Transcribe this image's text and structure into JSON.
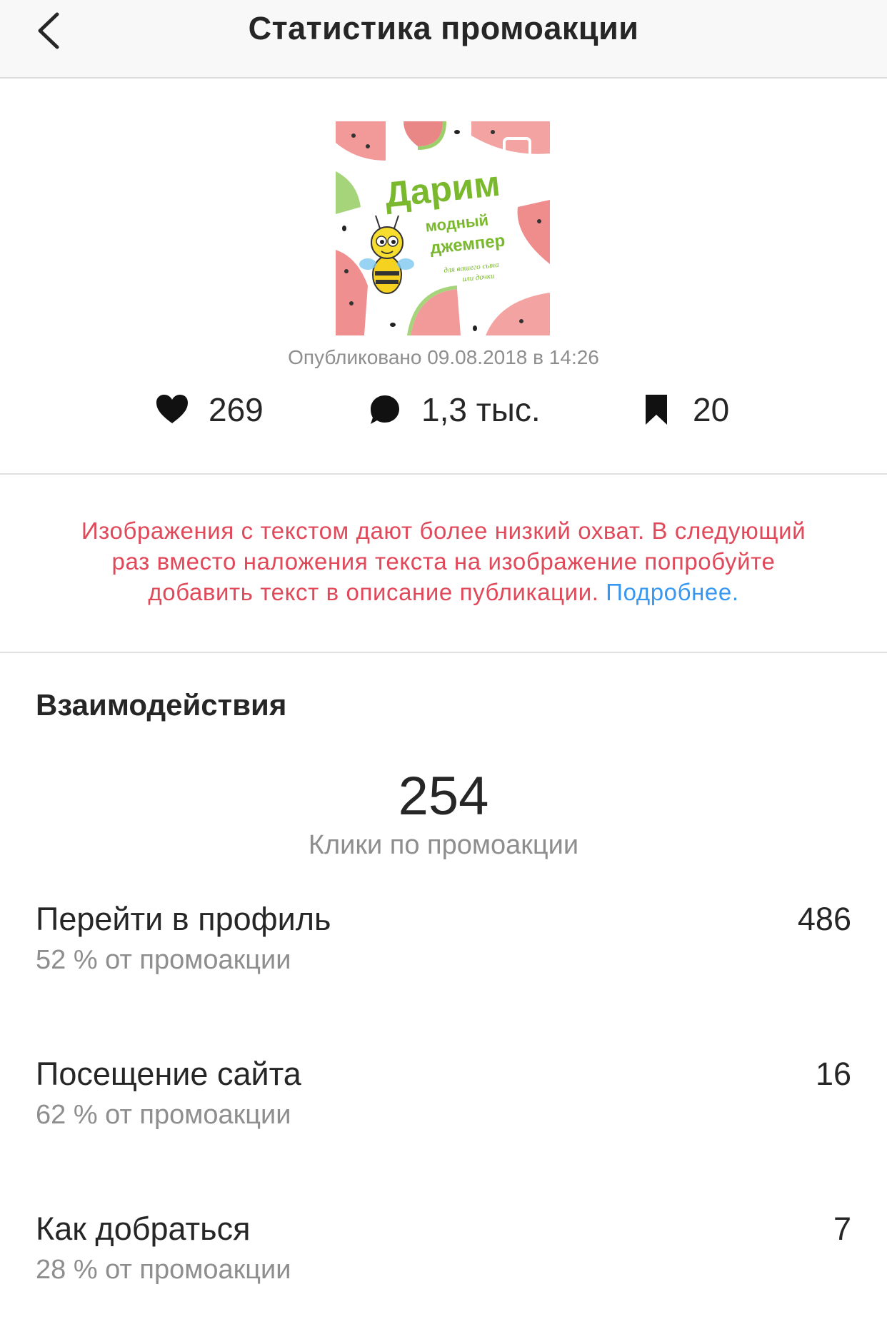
{
  "header": {
    "title": "Статистика промоакции"
  },
  "post": {
    "image": {
      "headline": "Дарим",
      "line1": "модный",
      "line2": "джемпер",
      "line3": "для вашего сына",
      "line4": "или дочки"
    },
    "published": "Опубликовано 09.08.2018 в 14:26",
    "likes": "269",
    "comments": "1,3 тыс.",
    "saves": "20"
  },
  "warning": {
    "line1": "Изображения с текстом дают более низкий охват. В следующий",
    "line2": "раз вместо наложения текста на изображение попробуйте",
    "line3": "добавить текст в описание публикации.",
    "link": "Подробнее."
  },
  "interactions": {
    "title": "Взаимодействия",
    "total": "254",
    "total_caption": "Клики по промоакции",
    "rows": [
      {
        "label": "Перейти в профиль",
        "sub": "52 % от промоакции",
        "value": "486"
      },
      {
        "label": "Посещение сайта",
        "sub": "62 % от промоакции",
        "value": "16"
      },
      {
        "label": "Как добраться",
        "sub": "28 % от промоакции",
        "value": "7"
      }
    ]
  },
  "colors": {
    "warning_text": "#e0495a",
    "link": "#3897f0",
    "primary_text": "#262626",
    "secondary_text": "#8e8e8e",
    "image_green": "#7ab82e"
  },
  "icons": {
    "back": "chevron-left-icon",
    "likes": "heart-icon",
    "comments": "comment-bubble-icon",
    "saves": "bookmark-icon",
    "multi_post": "carousel-icon"
  }
}
